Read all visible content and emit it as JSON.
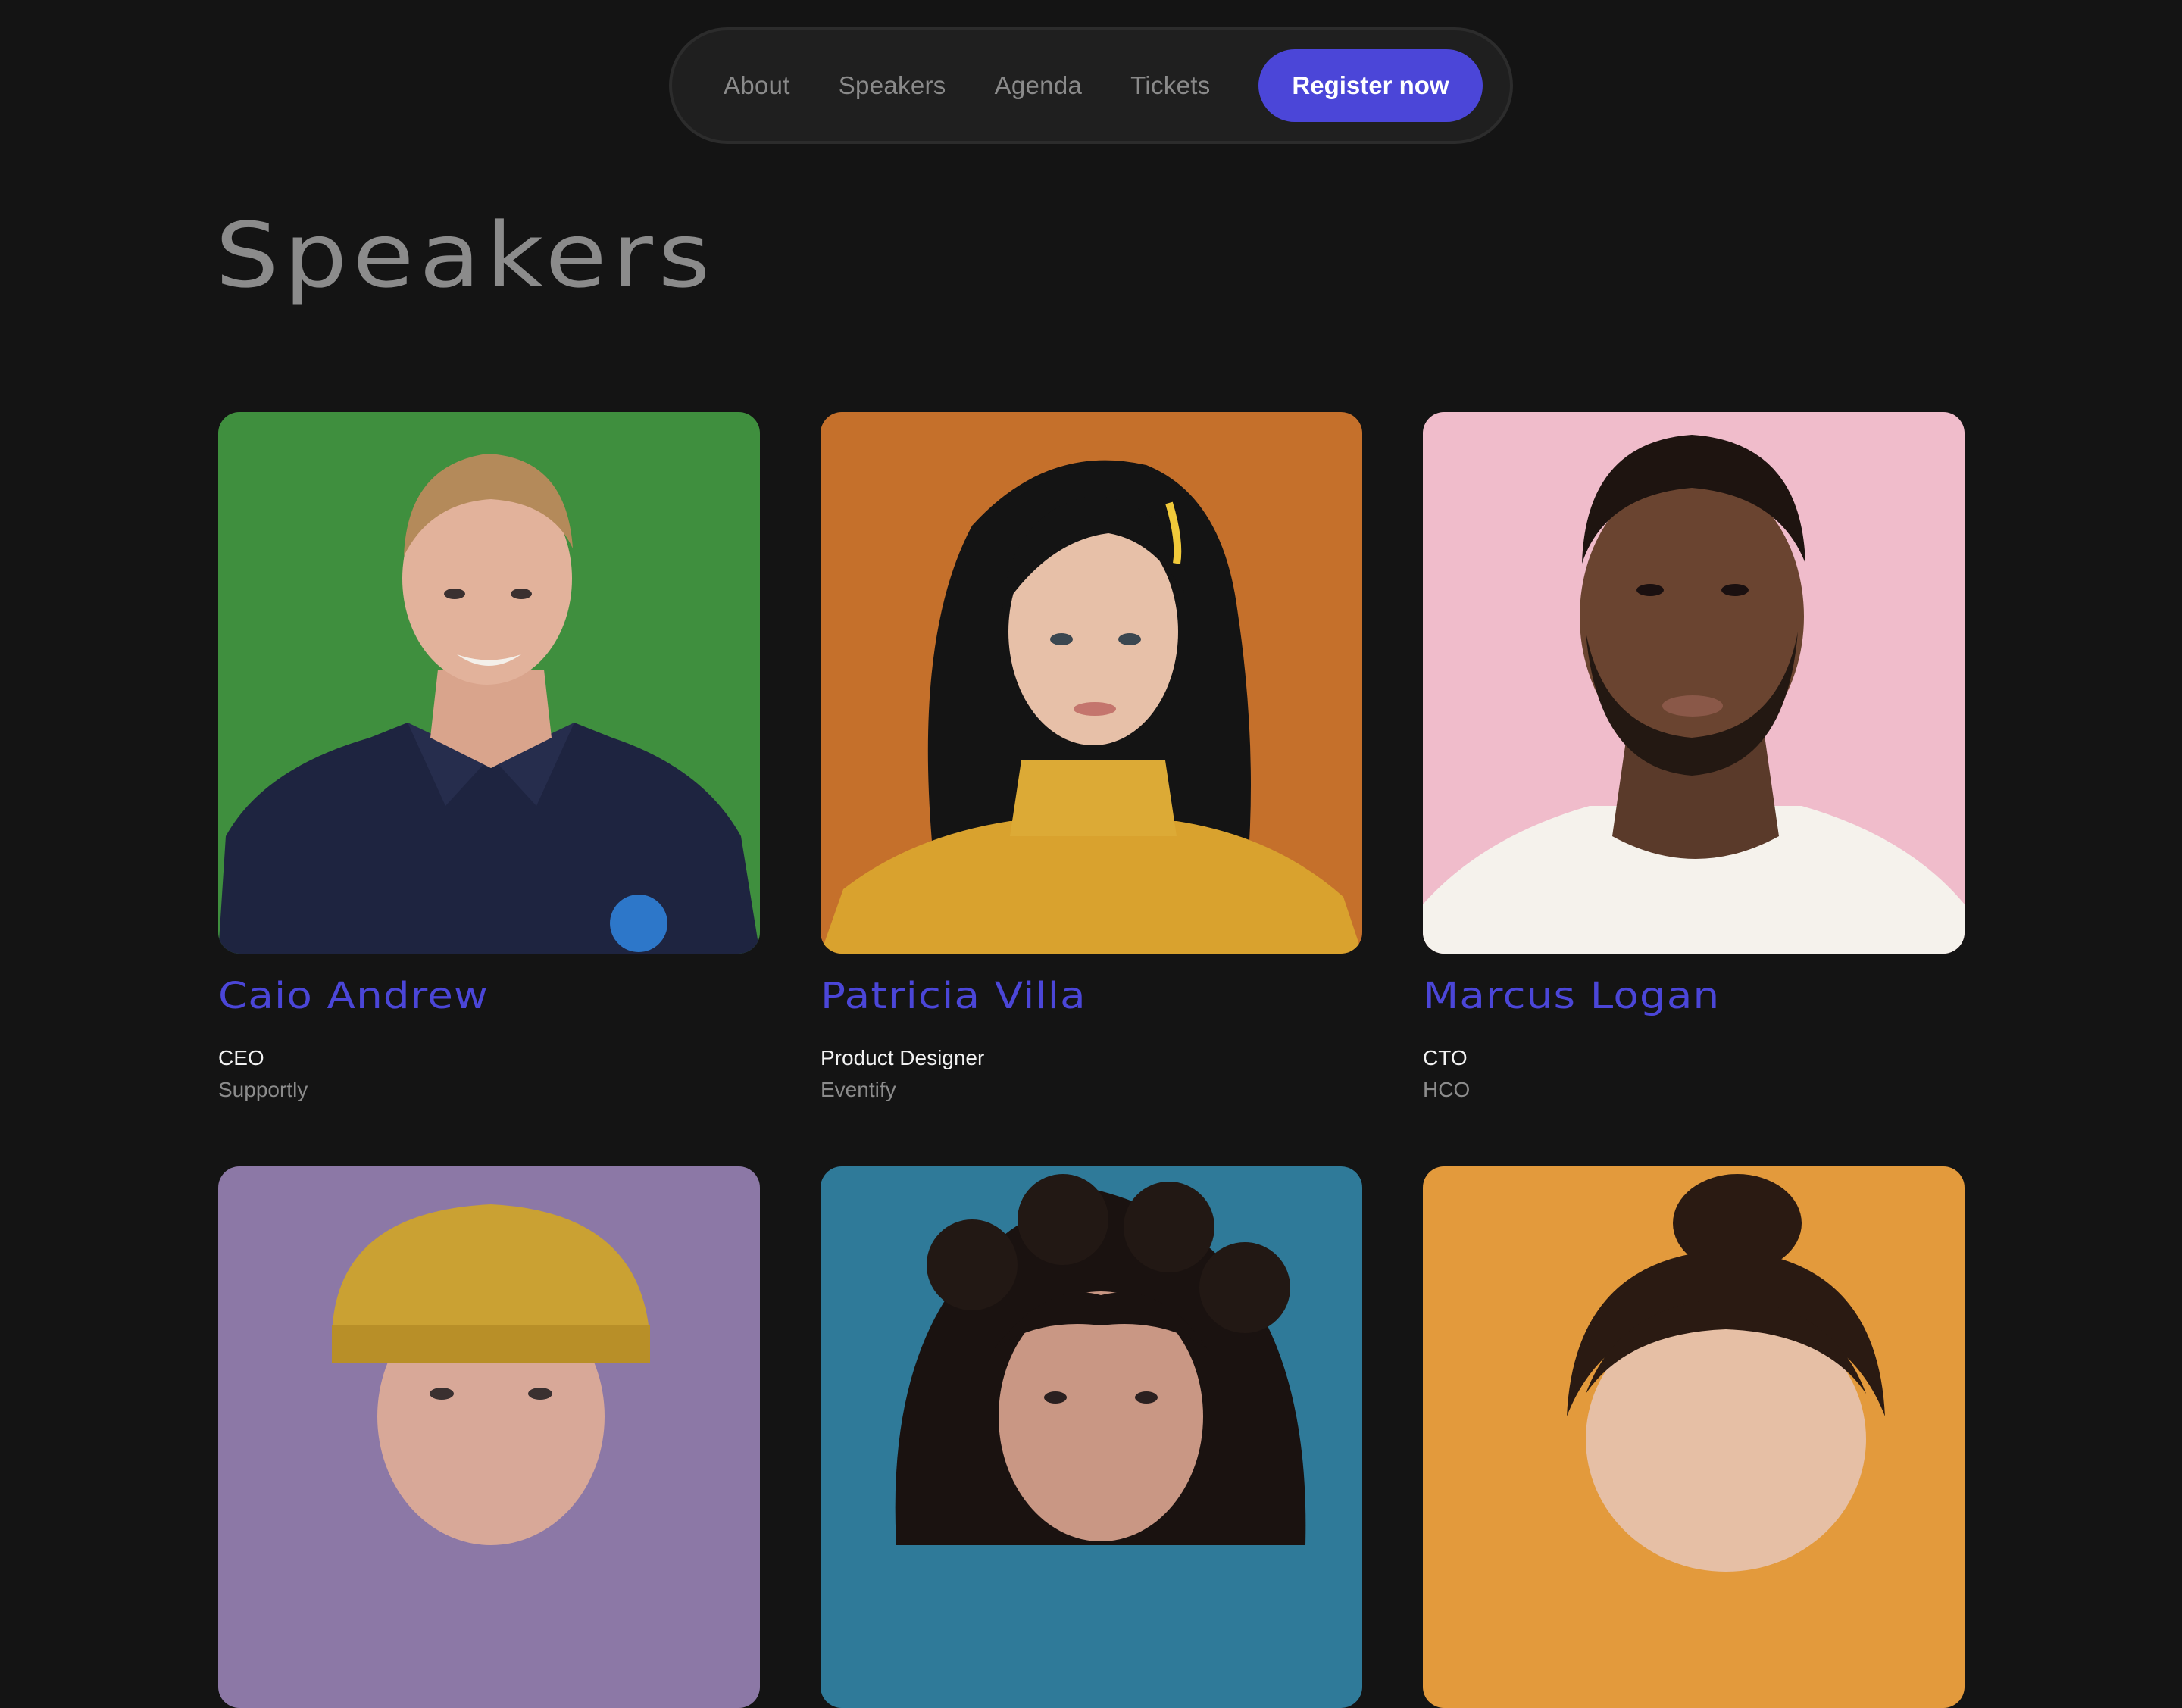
{
  "nav": {
    "links": [
      "About",
      "Speakers",
      "Agenda",
      "Tickets"
    ],
    "cta_label": "Register now"
  },
  "page": {
    "title": "Speakers"
  },
  "colors": {
    "background": "#141414",
    "accent": "#4b46d8",
    "nav_bg": "#1f1f1f"
  },
  "speakers": [
    {
      "name": "Caio Andrew",
      "role": "CEO",
      "company": "Supportly",
      "photo_bg": "#3f8f3e"
    },
    {
      "name": "Patricia Villa",
      "role": "Product Designer",
      "company": "Eventify",
      "photo_bg": "#c5702b"
    },
    {
      "name": "Marcus Logan",
      "role": "CTO",
      "company": "HCO",
      "photo_bg": "#f0bccb"
    },
    {
      "name": "",
      "role": "",
      "company": "",
      "photo_bg": "#8c78a6"
    },
    {
      "name": "",
      "role": "",
      "company": "",
      "photo_bg": "#2f7a99"
    },
    {
      "name": "",
      "role": "",
      "company": "",
      "photo_bg": "#e39a3c"
    }
  ]
}
